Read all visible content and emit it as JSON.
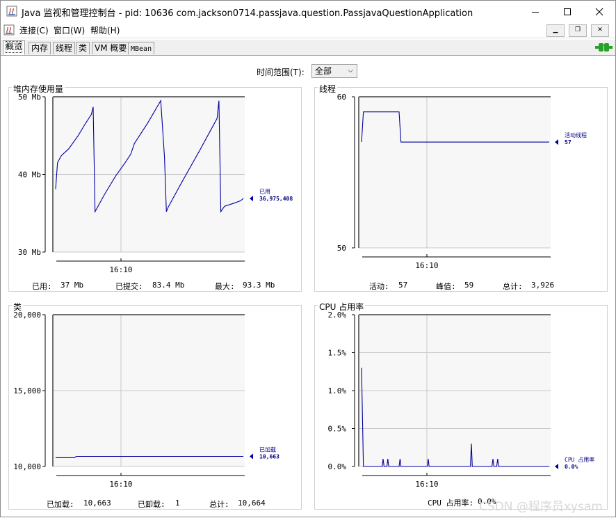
{
  "window": {
    "title": "Java 监视和管理控制台 - pid: 10636 com.jackson0714.passjava.question.PassjavaQuestionApplication",
    "minimize_icon": "minimize-icon",
    "maximize_icon": "maximize-icon",
    "close_icon": "close-icon"
  },
  "menu": {
    "items": [
      "连接(C)",
      "窗口(W)",
      "帮助(H)"
    ]
  },
  "tabs": [
    "概览",
    "内存",
    "线程",
    "类",
    "VM 概要",
    "MBean"
  ],
  "active_tab": "概览",
  "time_range": {
    "label": "时间范围(T):",
    "value": "全部"
  },
  "panels": {
    "heap": {
      "title": "堆内存使用量",
      "stats": {
        "used_label": "已用:",
        "used": "37  Mb",
        "committed_label": "已提交:",
        "committed": "83.4  Mb",
        "max_label": "最大:",
        "max": "93.3  Mb"
      },
      "legend": {
        "name": "已用",
        "value": "36,975,408"
      }
    },
    "threads": {
      "title": "线程",
      "stats": {
        "live_label": "活动:",
        "live": "57",
        "peak_label": "峰值:",
        "peak": "59",
        "total_label": "总计:",
        "total": "3,926"
      },
      "legend": {
        "name": "活动线程",
        "value": "57"
      }
    },
    "classes": {
      "title": "类",
      "stats": {
        "loaded_label": "已加载:",
        "loaded": "10,663",
        "unloaded_label": "已卸载:",
        "unloaded": "1",
        "total_label": "总计:",
        "total": "10,664"
      },
      "legend": {
        "name": "已加载",
        "value": "10,663"
      }
    },
    "cpu": {
      "title": "CPU 占用率",
      "stats": {
        "label": "CPU 占用率:",
        "value": "0.0%"
      },
      "legend": {
        "name": "CPU 占用率",
        "value": "0.0%"
      }
    }
  },
  "watermark": "CSDN @程序员xysam",
  "colors": {
    "series": "#0000a0",
    "accent_green": "#2aa02a"
  },
  "chart_data": [
    {
      "type": "line",
      "title": "堆内存使用量",
      "ylabel": "",
      "ylim": [
        30,
        50
      ],
      "yticks": [
        "30 Mb",
        "40 Mb",
        "50 Mb"
      ],
      "xticks": [
        "16:10"
      ],
      "series": [
        {
          "name": "已用",
          "x": [
            0,
            0.01,
            0.03,
            0.07,
            0.12,
            0.16,
            0.19,
            0.2,
            0.21,
            0.26,
            0.32,
            0.37,
            0.4,
            0.42,
            0.49,
            0.56,
            0.58,
            0.59,
            0.6,
            0.67,
            0.77,
            0.86,
            0.87,
            0.88,
            0.9,
            0.95,
            0.985,
            1
          ],
          "values": [
            38.1,
            41.5,
            42.4,
            43.3,
            45.0,
            46.6,
            47.7,
            48.7,
            35.2,
            37.4,
            39.8,
            41.5,
            42.6,
            44.0,
            46.6,
            49.5,
            42.2,
            35.2,
            35.8,
            38.9,
            43.2,
            47.2,
            49.5,
            35.2,
            35.9,
            36.3,
            36.6,
            36.9
          ]
        }
      ]
    },
    {
      "type": "line",
      "title": "线程",
      "ylim": [
        50,
        60
      ],
      "yticks": [
        "50",
        "60"
      ],
      "xticks": [
        "16:10"
      ],
      "series": [
        {
          "name": "活动线程",
          "x": [
            0,
            0.01,
            0.2,
            0.21,
            1
          ],
          "values": [
            57,
            59,
            59,
            57,
            57
          ]
        }
      ]
    },
    {
      "type": "line",
      "title": "类",
      "ylim": [
        10000,
        20000
      ],
      "yticks": [
        "10,000",
        "15,000",
        "20,000"
      ],
      "xticks": [
        "16:10"
      ],
      "series": [
        {
          "name": "已加载",
          "x": [
            0,
            0.1,
            0.11,
            1
          ],
          "values": [
            10580,
            10580,
            10663,
            10663
          ]
        }
      ]
    },
    {
      "type": "line",
      "title": "CPU 占用率",
      "ylim": [
        0,
        2.0
      ],
      "yticks": [
        "0.0%",
        "0.5%",
        "1.0%",
        "1.5%",
        "2.0%"
      ],
      "xticks": [
        "16:10"
      ],
      "series": [
        {
          "name": "CPU 占用率",
          "x": [
            0,
            0.01,
            0.11,
            0.115,
            0.12,
            0.135,
            0.14,
            0.145,
            0.2,
            0.205,
            0.21,
            0.35,
            0.355,
            0.36,
            0.58,
            0.585,
            0.59,
            0.695,
            0.7,
            0.705,
            0.72,
            0.725,
            0.73,
            1
          ],
          "values": [
            1.3,
            0.0,
            0.0,
            0.1,
            0.0,
            0.0,
            0.1,
            0.0,
            0.0,
            0.1,
            0.0,
            0.0,
            0.1,
            0.0,
            0.0,
            0.3,
            0.0,
            0.0,
            0.1,
            0.0,
            0.0,
            0.1,
            0.0,
            0.0
          ]
        }
      ]
    }
  ]
}
